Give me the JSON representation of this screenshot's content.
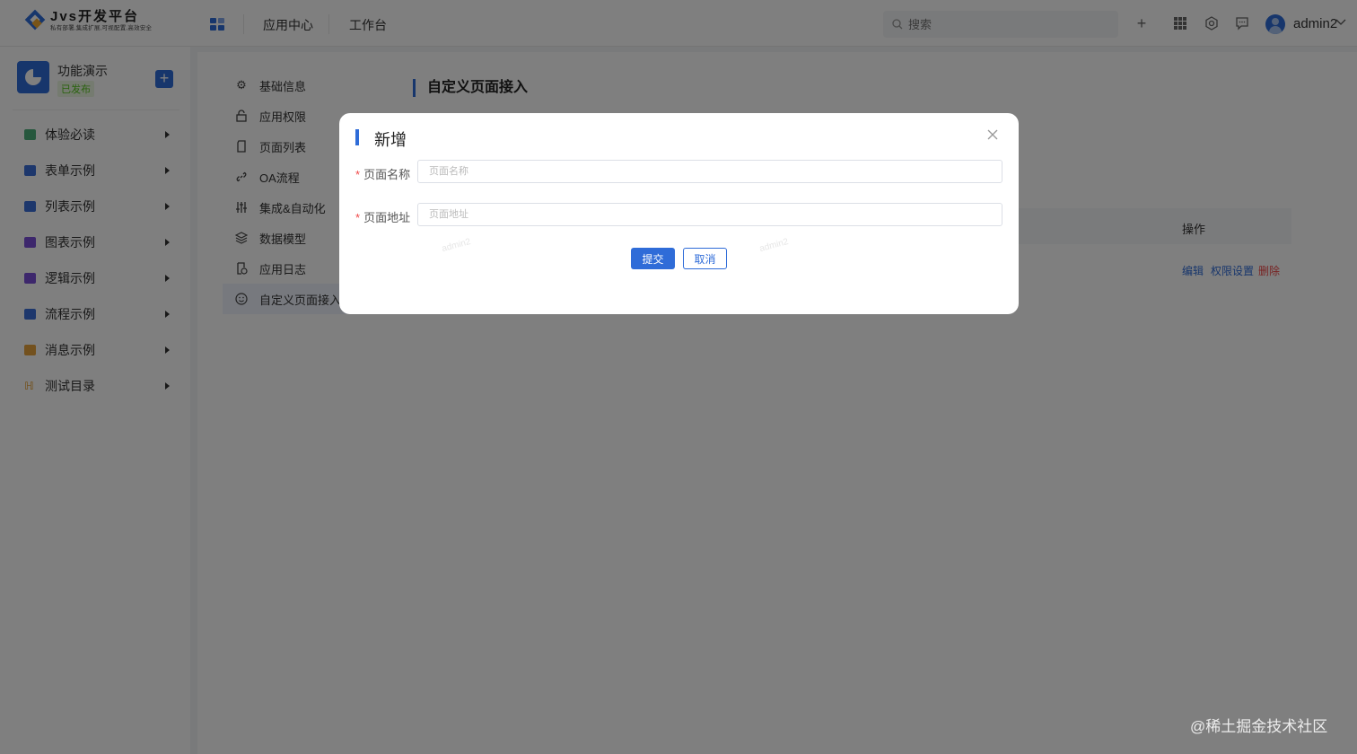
{
  "brand": {
    "title": "Jvs开发平台",
    "subtitle": "私有部署,集成扩展,可视配置,高效安全"
  },
  "topnav": {
    "items": [
      "应用中心",
      "工作台"
    ]
  },
  "search": {
    "placeholder": "搜索"
  },
  "user": {
    "name": "admin2"
  },
  "app": {
    "name": "功能演示",
    "status": "已发布"
  },
  "sidebar": {
    "items": [
      {
        "label": "体验必读",
        "color": "#4caf7a"
      },
      {
        "label": "表单示例",
        "color": "#3a6fd8"
      },
      {
        "label": "列表示例",
        "color": "#3a6fd8"
      },
      {
        "label": "图表示例",
        "color": "#7a4fd8"
      },
      {
        "label": "逻辑示例",
        "color": "#7a4fd8"
      },
      {
        "label": "流程示例",
        "color": "#3a6fd8"
      },
      {
        "label": "消息示例",
        "color": "#e6a23c"
      },
      {
        "label": "测试目录",
        "color": "#e6a23c"
      }
    ]
  },
  "submenu": {
    "items": [
      "基础信息",
      "应用权限",
      "页面列表",
      "OA流程",
      "集成&自动化",
      "数据模型",
      "应用日志",
      "自定义页面接入"
    ]
  },
  "section": {
    "title": "自定义页面接入"
  },
  "table": {
    "op_header": "操作",
    "actions": [
      "编辑",
      "权限设置",
      "删除"
    ]
  },
  "modal": {
    "title": "新增",
    "fields": [
      {
        "label": "页面名称",
        "placeholder": "页面名称"
      },
      {
        "label": "页面地址",
        "placeholder": "页面地址"
      }
    ],
    "submit": "提交",
    "cancel": "取消",
    "watermarks": [
      "admin2",
      "admin2"
    ]
  },
  "corner_watermark": "@稀土掘金技术社区",
  "colors": {
    "accent": "#2f6cd8",
    "danger": "#f04848",
    "success": "#52c41a"
  }
}
